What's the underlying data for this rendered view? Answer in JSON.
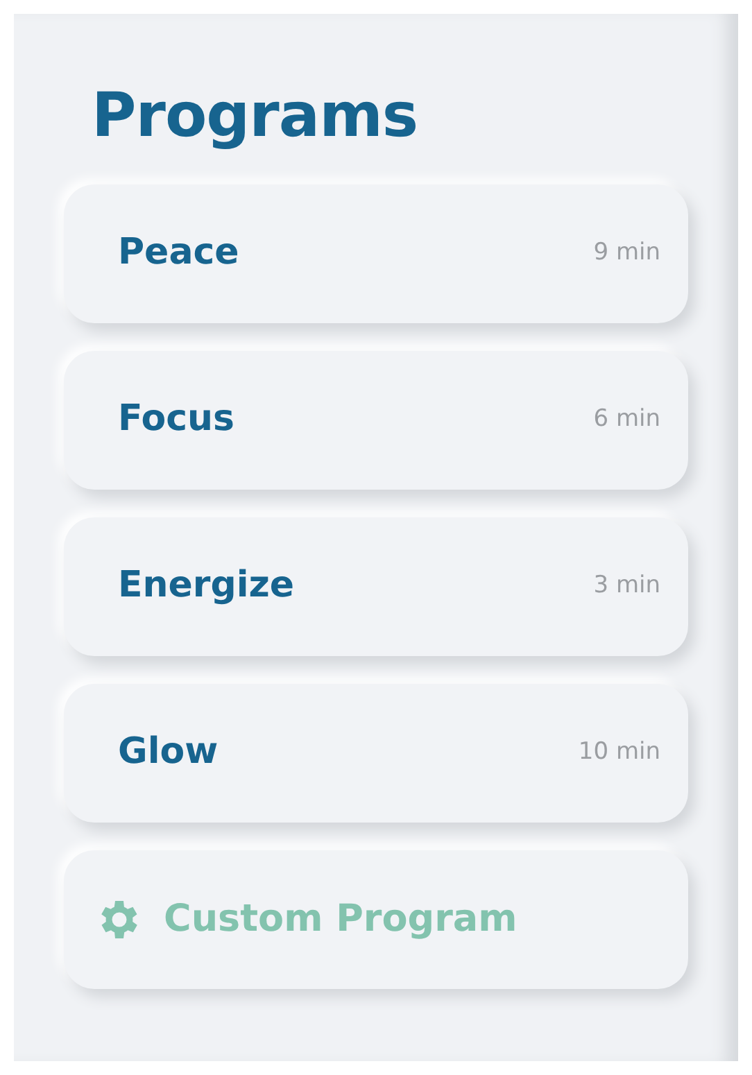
{
  "title": "Programs",
  "programs": [
    {
      "name": "Peace",
      "duration": "9 min"
    },
    {
      "name": "Focus",
      "duration": "6 min"
    },
    {
      "name": "Energize",
      "duration": "3 min"
    },
    {
      "name": "Glow",
      "duration": "10 min"
    }
  ],
  "custom_button": {
    "label": "Custom Program"
  }
}
